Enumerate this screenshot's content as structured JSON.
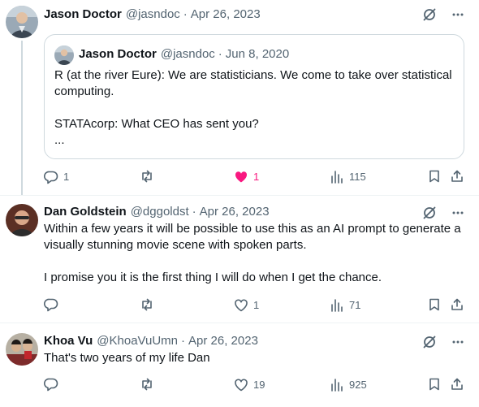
{
  "tweets": [
    {
      "author": "Jason Doctor",
      "handle": "@jasndoc",
      "date": "Apr 26, 2023",
      "quote": {
        "author": "Jason Doctor",
        "handle": "@jasndoc",
        "date": "Jun 8, 2020",
        "lines": [
          "R (at the river Eure): We are statisticians. We come to take over statistical computing.",
          "STATAcorp: What CEO has sent you?",
          "..."
        ]
      },
      "replies": "1",
      "retweets": "",
      "likes": "1",
      "views": "115"
    },
    {
      "author": "Dan Goldstein",
      "handle": "@dggoldst",
      "date": "Apr 26, 2023",
      "lines": [
        "Within a few years it will be possible to use this as an AI prompt to generate a visually stunning movie scene with spoken parts.",
        "I promise you it is the first thing I will do when I get the chance."
      ],
      "replies": "",
      "retweets": "",
      "likes": "1",
      "views": "71"
    },
    {
      "author": "Khoa Vu",
      "handle": "@KhoaVuUmn",
      "date": "Apr 26, 2023",
      "lines": [
        "That's two years of my life Dan"
      ],
      "replies": "",
      "retweets": "",
      "likes": "19",
      "views": "925"
    }
  ],
  "separator": "·",
  "icons": {
    "grok": "grok-slash-icon",
    "more": "more-dots-icon",
    "reply": "reply-icon",
    "retweet": "retweet-icon",
    "like": "heart-icon",
    "views": "views-chart-icon",
    "bookmark": "bookmark-icon",
    "share": "share-icon"
  },
  "colors": {
    "text": "#0f1419",
    "secondary": "#536471",
    "like_active": "#f91880",
    "border": "#cfd9de"
  }
}
